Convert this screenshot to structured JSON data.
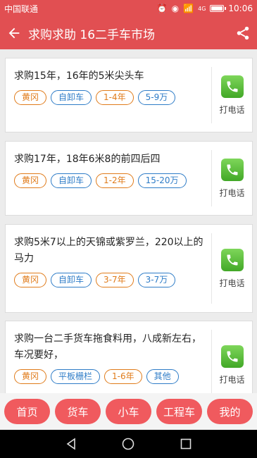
{
  "status": {
    "carrier": "中国联通",
    "network": "4G",
    "time": "10:06",
    "battery_level": 0.85
  },
  "header": {
    "title": "求购求助 16二手车市场",
    "back_icon": "arrow-left-icon",
    "share_icon": "share-icon"
  },
  "listings": [
    {
      "text": "求购15年，16年的5米尖头车",
      "tags": [
        "黄冈",
        "自卸车",
        "1-4年",
        "5-9万"
      ],
      "call_label": "打电话"
    },
    {
      "text": "求购17年，18年6米8的前四后四",
      "tags": [
        "黄冈",
        "自卸车",
        "1-2年",
        "15-20万"
      ],
      "call_label": "打电话"
    },
    {
      "text": "求购5米7以上的天锦或紫罗兰，220以上的马力",
      "tags": [
        "黄冈",
        "自卸车",
        "3-7年",
        "3-7万"
      ],
      "call_label": "打电话"
    },
    {
      "text": "求购一台二手货车拖食料用，八成新左右，车况要好，",
      "tags": [
        "黄冈",
        "平板栅栏",
        "1-6年",
        "其他"
      ],
      "call_label": "打电话"
    }
  ],
  "bottom_nav": [
    "首页",
    "货车",
    "小车",
    "工程车",
    "我的"
  ],
  "colors": {
    "primary": "#e14f52",
    "nav_button": "#f05a5e",
    "tag_orange": "#e07b1a",
    "tag_blue": "#2e7cc7",
    "call_green": "#4cb52f"
  }
}
